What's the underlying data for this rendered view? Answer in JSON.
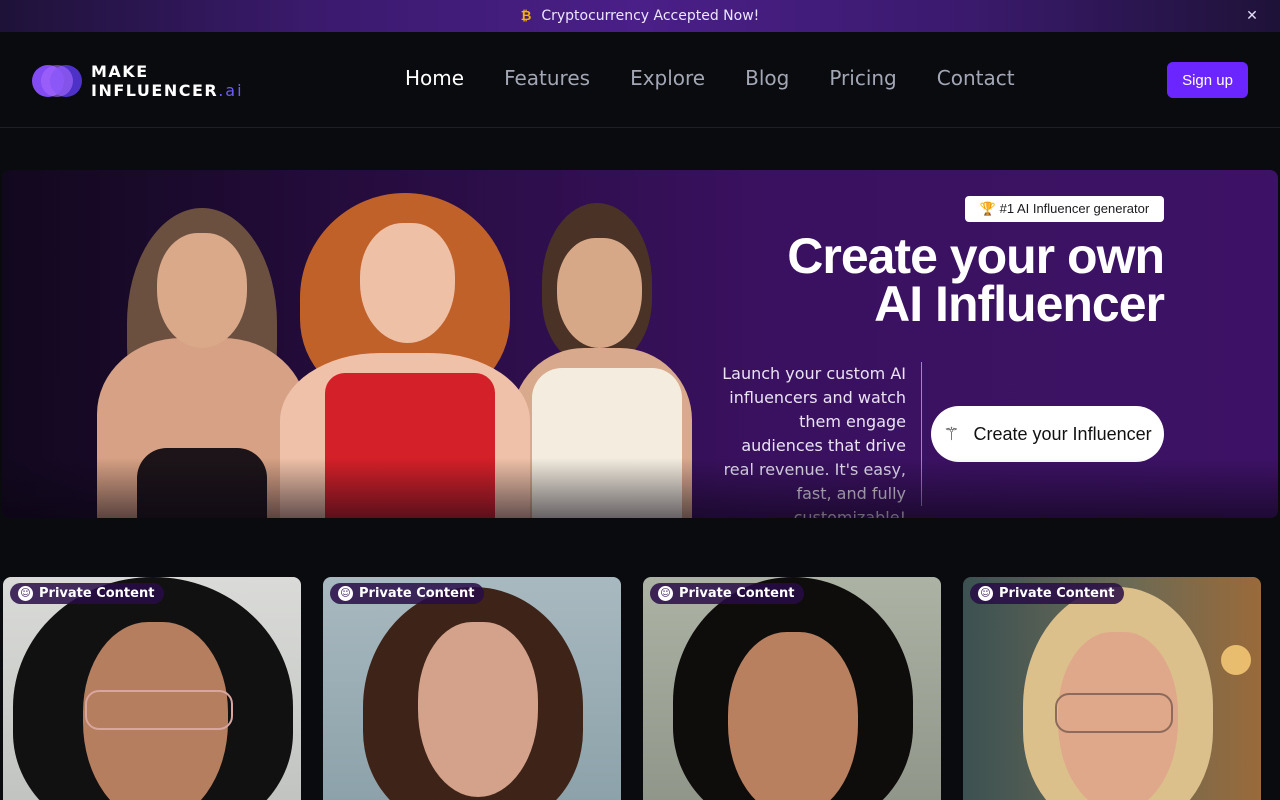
{
  "announcement": {
    "icon": "bitcoin-icon",
    "icon_glyph": "₿",
    "text": "Cryptocurrency Accepted Now!",
    "close_glyph": "✕"
  },
  "nav": {
    "logo": {
      "line1": "MAKE",
      "line2": "INFLUENCER",
      "suffix": ".ai"
    },
    "items": [
      {
        "label": "Home",
        "active": true
      },
      {
        "label": "Features",
        "active": false
      },
      {
        "label": "Explore",
        "active": false
      },
      {
        "label": "Blog",
        "active": false
      },
      {
        "label": "Pricing",
        "active": false
      },
      {
        "label": "Contact",
        "active": false
      }
    ],
    "signup_label": "Sign up"
  },
  "hero": {
    "badge": "🏆 #1 AI Influencer generator",
    "headline_line1": "Create your own",
    "headline_line2": "AI Influencer",
    "description": "Launch your custom AI influencers and watch them engage audiences that drive real revenue. It's easy, fast, and fully customizable!",
    "cta_label": "Create your Influencer",
    "cta_icon": "magic-wand-icon"
  },
  "cards": [
    {
      "badge": "Private Content"
    },
    {
      "badge": "Private Content"
    },
    {
      "badge": "Private Content"
    },
    {
      "badge": "Private Content"
    }
  ],
  "colors": {
    "accent": "#6b26ff",
    "background": "#0a0b0f",
    "hero_gradient_end": "#3d1266"
  }
}
